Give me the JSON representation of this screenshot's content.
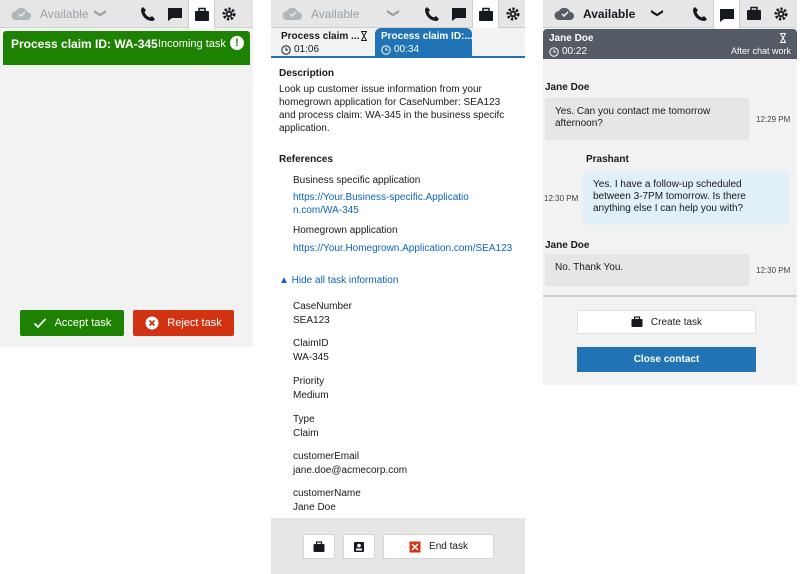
{
  "colors": {
    "accept_green": "#1d8102",
    "reject_red": "#d13212",
    "primary_blue": "#2073b5",
    "link_blue": "#0b63c4",
    "header_gray": "#545b64"
  },
  "panel1": {
    "status_label": "Available",
    "icons": [
      "phone-icon",
      "chat-icon",
      "briefcase-icon",
      "gear-icon"
    ],
    "active_icon": "briefcase-icon",
    "task": {
      "title": "Process claim ID: WA-345",
      "subtitle": "Incoming task",
      "alert": "!"
    },
    "accept_label": "Accept task",
    "reject_label": "Reject task"
  },
  "panel2": {
    "status_label": "Available",
    "tabs": [
      {
        "title": "Process claim ...",
        "time": "01:06",
        "active": false
      },
      {
        "title": "Process claim ID:...",
        "time": "00:34",
        "active": true
      }
    ],
    "description_heading": "Description",
    "description_text": "Look up customer issue information from your homegrown application for CaseNumber: SEA123 and process claim: WA-345 in the business specifc application.",
    "references_heading": "References",
    "references": [
      {
        "label": "Business specific application",
        "url": "https://Your.Business-specific.Application.com/WA-345"
      },
      {
        "label": "Homegrown application",
        "url": "https://Your.Homegrown.Application.com/SEA123"
      }
    ],
    "hide_all_label": "▲ Hide all task information",
    "attributes": [
      {
        "key": "CaseNumber",
        "value": "SEA123"
      },
      {
        "key": "ClaimID",
        "value": "WA-345"
      },
      {
        "key": "Priority",
        "value": "Medium"
      },
      {
        "key": "Type",
        "value": "Claim"
      },
      {
        "key": "customerEmail",
        "value": "jane.doe@acmecorp.com"
      },
      {
        "key": "customerName",
        "value": "Jane Doe"
      }
    ],
    "end_task_label": "End task"
  },
  "panel3": {
    "status_label": "Available",
    "contact": {
      "name": "Jane Doe",
      "time": "00:22",
      "state": "After chat work"
    },
    "messages": [
      {
        "sender": "Jane Doe",
        "text": "Yes. Can you contact me tomorrow afternoon?",
        "time": "12:29 PM",
        "from": "customer"
      },
      {
        "sender": "Prashant",
        "text": "Yes. I have a follow-up scheduled between 3-7PM tomorrow. Is there anything else I can help you with?",
        "time": "12:30 PM",
        "from": "agent"
      },
      {
        "sender": "Jane Doe",
        "text": "No. Thank You.",
        "time": "12:30 PM",
        "from": "customer"
      }
    ],
    "create_task_label": "Create task",
    "close_contact_label": "Close contact"
  }
}
